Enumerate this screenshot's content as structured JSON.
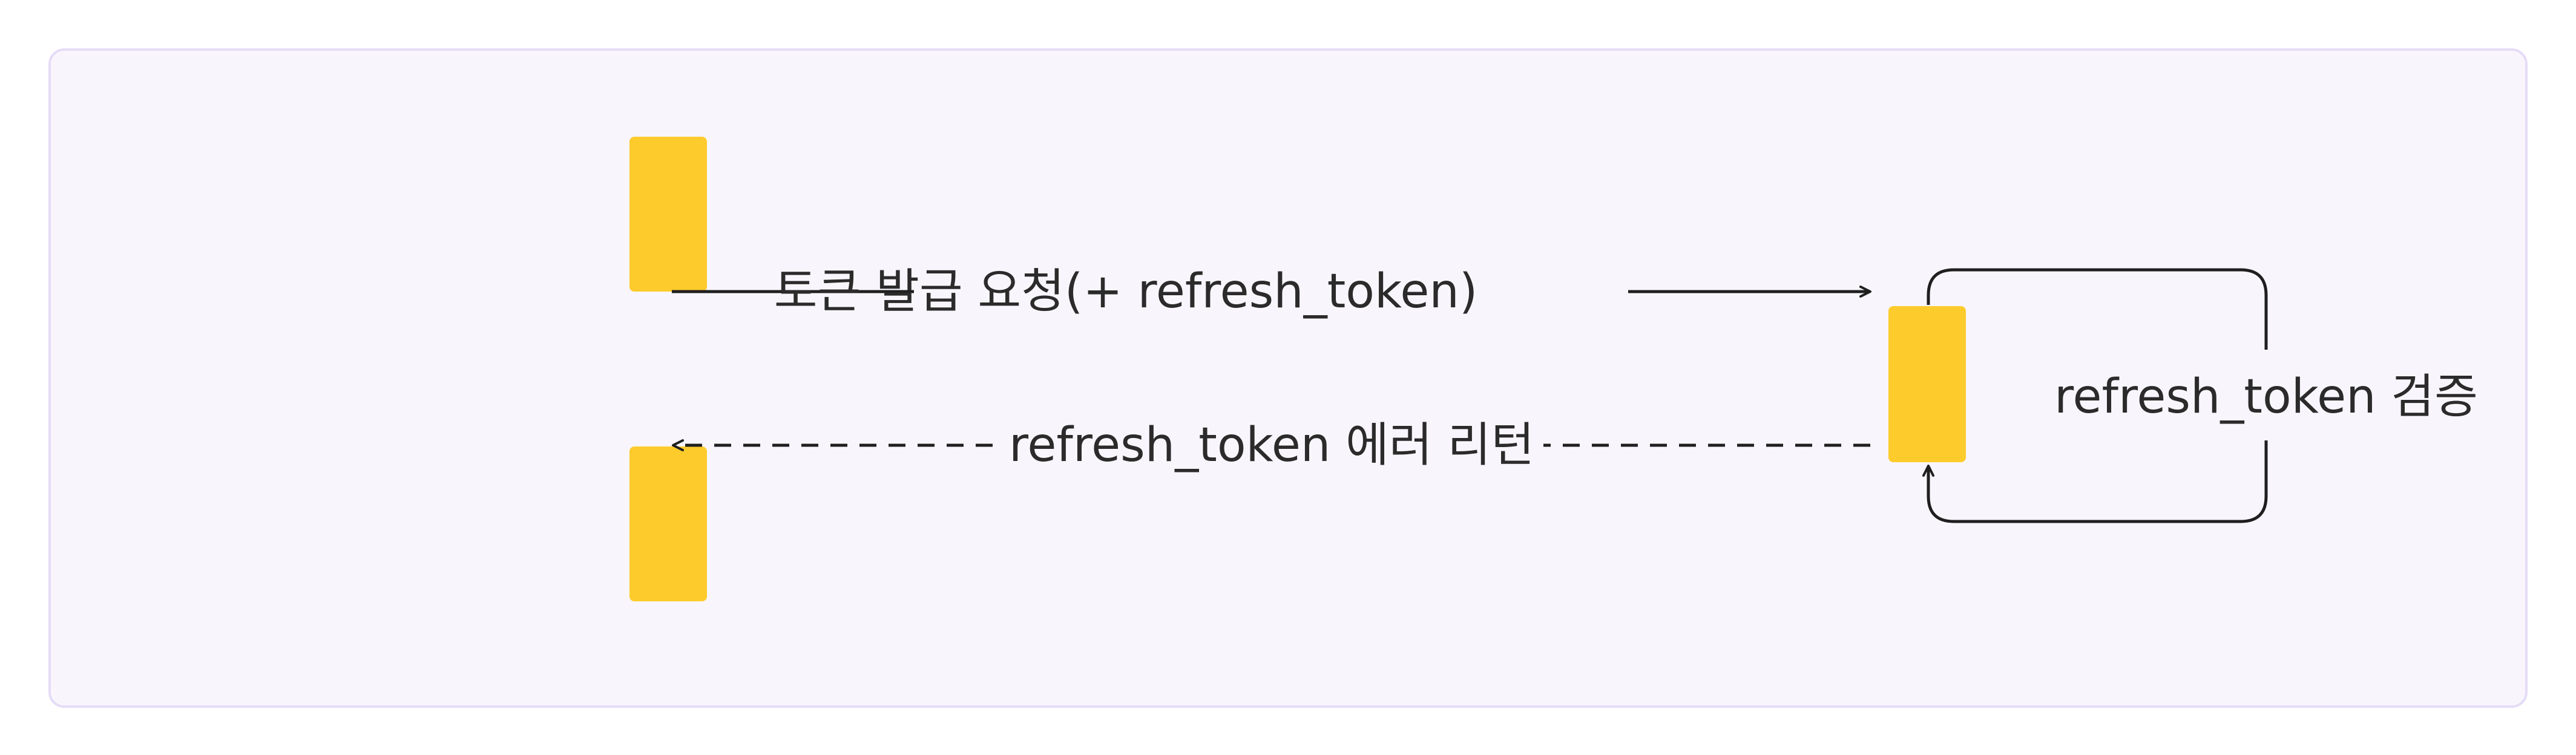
{
  "colors": {
    "panel_fill": "#f8f6fc",
    "panel_border": "#e5dcf7",
    "activation": "#fdcb2c",
    "stroke": "#1f1f1f",
    "text": "#2b2b2b"
  },
  "messages": {
    "request": "토큰 발급 요청(+ refresh_token)",
    "error_return": "refresh_token 에러 리턴",
    "self_check": "refresh_token 검증"
  }
}
